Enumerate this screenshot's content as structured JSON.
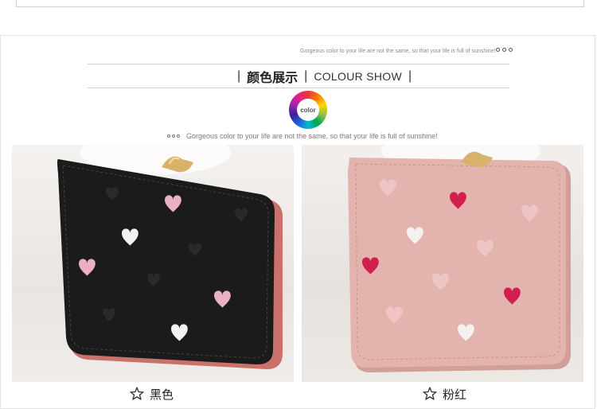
{
  "header": {
    "tagline_small": "Gorgeous color to your life are not the same, so that your life is full of sunshine!",
    "title_zh": "颜色展示",
    "title_en": "COLOUR SHOW",
    "title_divider": "|",
    "color_badge": "color",
    "tagline": "Gorgeous color to your life are not the same, so that your life is full of sunshine!"
  },
  "variants": [
    {
      "label": "黑色",
      "icon": "star-outline-icon",
      "wallet_color": "#1b1b1b",
      "accent": "#e9b2c2"
    },
    {
      "label": "粉红",
      "icon": "star-outline-icon",
      "wallet_color": "#e3b4ad",
      "accent": "#d01e4f"
    }
  ],
  "colors": {
    "border": "#e2e2e2",
    "text": "#222222",
    "muted": "#7a7a7a"
  }
}
